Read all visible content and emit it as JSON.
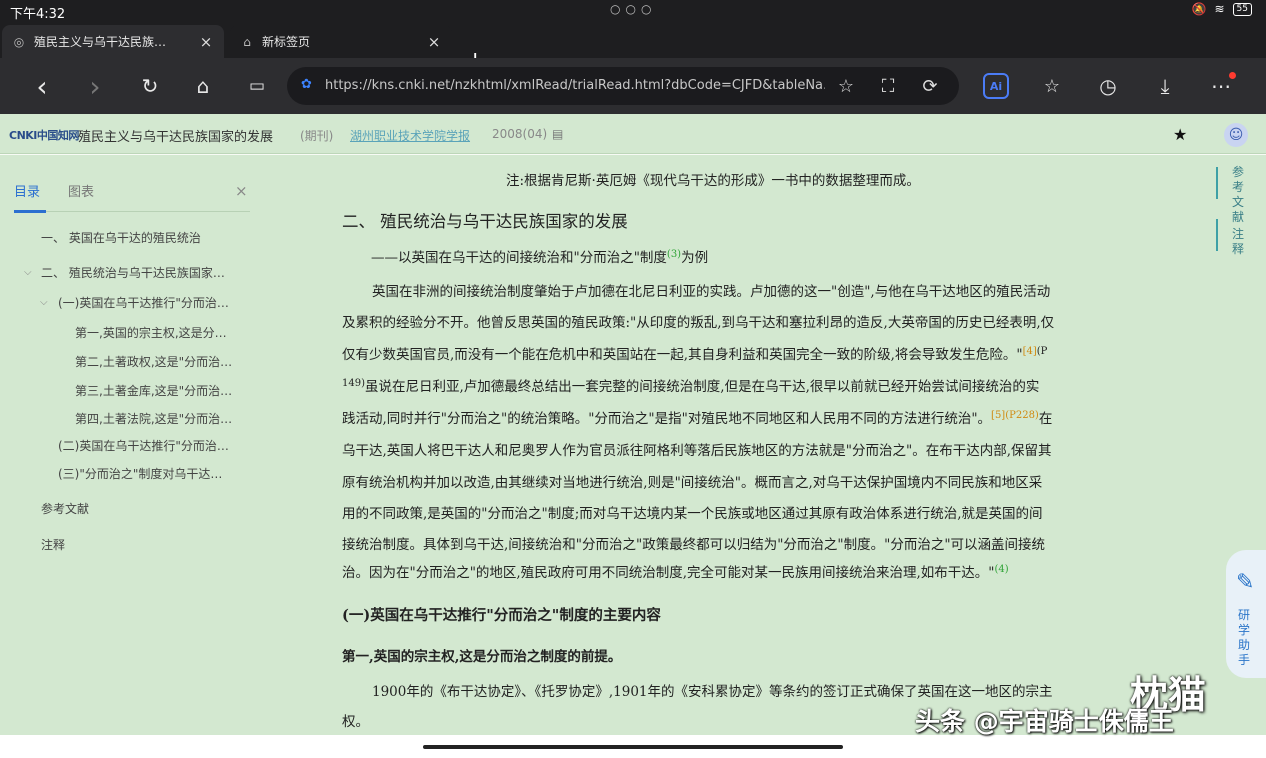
{
  "status": {
    "time": "下午4:32",
    "dots": "○○○",
    "battery": "55"
  },
  "tabs": [
    {
      "title": "殖民主义与乌干达民族…",
      "close": "×"
    },
    {
      "title": "新标签页",
      "close": "×"
    }
  ],
  "newtab": "+",
  "toolbar": {
    "back": "‹",
    "forward": "›",
    "url": "https://kns.cnki.net/nzkhtml/xmlRead/trialRead.html?dbCode=CJFD&tableNa…",
    "ai_label": "Ai"
  },
  "doc": {
    "logo": "CNKI中国知网",
    "title": "殖民主义与乌干达民族国家的发展",
    "journal_type": "(期刊)",
    "journal": "湖州职业技术学院学报",
    "issue": "2008(04)"
  },
  "sidebar": {
    "tabs": [
      "目录",
      "图表"
    ],
    "close": "×",
    "items": [
      "一、 英国在乌干达的殖民统治",
      "二、 殖民统治与乌干达民族国家…",
      "(一)英国在乌干达推行\"分而治…",
      "第一,英国的宗主权,这是分…",
      "第二,土著政权,这是\"分而治…",
      "第三,土著金库,这是\"分而治…",
      "第四,土著法院,这是\"分而治…",
      "(二)英国在乌干达推行\"分而治…",
      "(三)\"分而治之\"制度对乌干达…",
      "参考文献",
      "注释"
    ]
  },
  "content": {
    "note": "注:根据肯尼斯·英厄姆《现代乌干达的形成》一书中的数据整理而成。",
    "heading": "二、 殖民统治与乌干达民族国家的发展",
    "subheading_pre": "——以英国在乌干达的间接统治和\"分而治之\"制度",
    "subheading_sup": "(3)",
    "subheading_post": "为例",
    "p1": [
      "英国在非洲的间接统治制度肇始于卢加德在北尼日利亚的实践。卢加德的这一\"创造\",与他在乌干达地区的殖民活动",
      "及累积的经验分不开。他曾反思英国的殖民政策:\"从印度的叛乱,到乌干达和塞拉利昂的造反,大英帝国的历史已经表明,仅",
      "仅有少数英国官员,而没有一个能在危机中和英国站在一起,其自身利益和英国完全一致的阶级,将会导致发生危险。\""
    ],
    "p1_ref1": "[4]",
    "p1_ref1_page": "(P",
    "p1_line4_pre": "149)",
    "p1_line4": "虽说在尼日利亚,卢加德最终总结出一套完整的间接统治制度,但是在乌干达,很早以前就已经开始尝试间接统治的实",
    "p1_line5": "践活动,同时并行\"分而治之\"的统治策略。\"分而治之\"是指\"对殖民地不同地区和人民用不同的方法进行统治\"。",
    "p1_ref2": "[5](P228)",
    "p1_line5_post": "在",
    "p2": [
      "乌干达,英国人将巴干达人和尼奥罗人作为官员派往阿格利等落后民族地区的方法就是\"分而治之\"。在布干达内部,保留其",
      "原有统治机构并加以改造,由其继续对当地进行统治,则是\"间接统治\"。概而言之,对乌干达保护国境内不同民族和地区采",
      "用的不同政策,是英国的\"分而治之\"制度;而对乌干达境内某一个民族或地区通过其原有政治体系进行统治,就是英国的间",
      "接统治制度。具体到乌干达,间接统治和\"分而治之\"政策最终都可以归结为\"分而治之\"制度。\"分而治之\"可以涵盖间接统"
    ],
    "p2_last": "治。因为在\"分而治之\"的地区,殖民政府可用不同统治制度,完全可能对某一民族用间接统治来治理,如布干达。\"",
    "p2_ref": "(4)",
    "h3": "(一)英国在乌干达推行\"分而治之\"制度的主要内容",
    "h4": "第一,英国的宗主权,这是分而治之制度的前提。",
    "p3_line1": "1900年的《布干达协定》、《托罗协定》,1901年的《安科累协定》等条约的签订正式确保了英国在这一地区的宗主",
    "p3_line2": "权。"
  },
  "rail": {
    "ref": "参考文献",
    "notes": "注释",
    "helper": "研学助手"
  },
  "watermark": {
    "brand": "枕猫",
    "credit": "头条 @宇宙骑士侏儒王"
  }
}
